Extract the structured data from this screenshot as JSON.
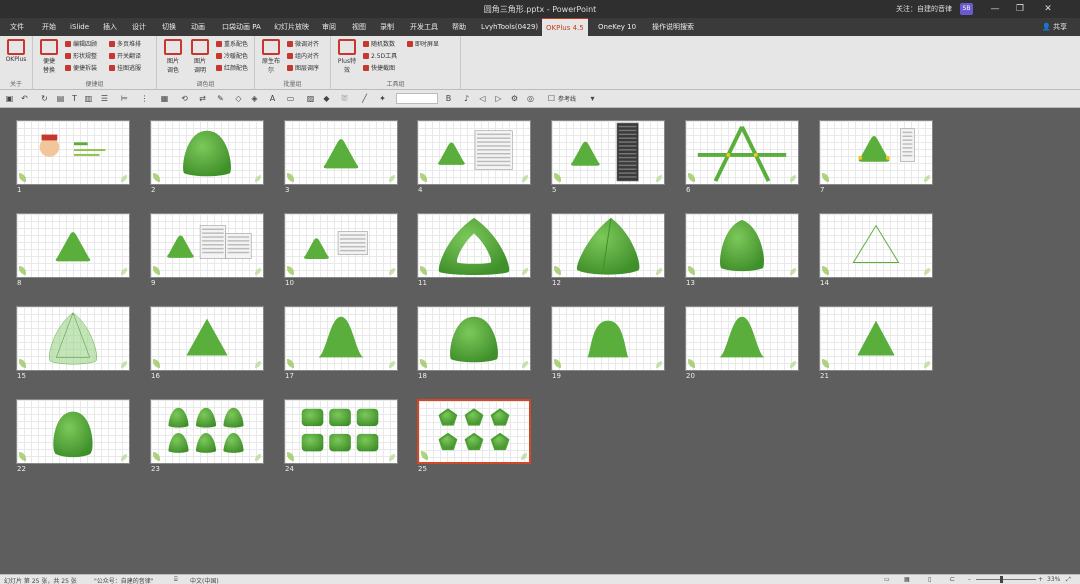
{
  "window": {
    "title": "圆角三角形.pptx - PowerPoint",
    "follow_text": "关注：自建的音律",
    "account_badge": "SB",
    "minimize": "—",
    "restore": "❐",
    "close": "✕"
  },
  "tabs": [
    {
      "label": "文件",
      "active": false
    },
    {
      "label": "开始",
      "active": false
    },
    {
      "label": "iSlide",
      "active": false
    },
    {
      "label": "插入",
      "active": false
    },
    {
      "label": "设计",
      "active": false
    },
    {
      "label": "切换",
      "active": false
    },
    {
      "label": "动画",
      "active": false
    },
    {
      "label": "口袋动画 PA",
      "active": false
    },
    {
      "label": "幻灯片放映",
      "active": false
    },
    {
      "label": "审阅",
      "active": false
    },
    {
      "label": "视图",
      "active": false
    },
    {
      "label": "录制",
      "active": false
    },
    {
      "label": "开发工具",
      "active": false
    },
    {
      "label": "帮助",
      "active": false
    },
    {
      "label": "LvyhTools(0429)",
      "active": false
    },
    {
      "label": "OKPlus 4.5",
      "active": true
    },
    {
      "label": "OneKey 10",
      "active": false
    },
    {
      "label": "操作说明搜索",
      "active": false
    }
  ],
  "share_label": "共享",
  "ribbon": {
    "groups": [
      {
        "label": "关于",
        "big": [
          {
            "label": "OKPlus",
            "icon": "okplus-logo-icon"
          }
        ],
        "small": []
      },
      {
        "label": "便捷组",
        "big": [
          {
            "label": "便捷\n替换",
            "icon": "replace-icon"
          }
        ],
        "small": [
          "编辑四顾",
          "形状规整",
          "便捷拆装",
          "多页堆排",
          "开关翻译",
          "挂图逃服"
        ]
      },
      {
        "label": "调色组",
        "big": [
          {
            "label": "图片\n调色",
            "icon": "img-icon"
          },
          {
            "label": "图片\n调明",
            "icon": "img-adjust-icon"
          }
        ],
        "small": [
          "重系配色",
          "冷暖配色",
          "红颜配色"
        ]
      },
      {
        "label": "批量组",
        "big": [
          {
            "label": "原生布\n尔",
            "icon": "boolean-icon"
          }
        ],
        "small": [
          "微调对齐",
          "组内对齐",
          "图层调序"
        ]
      },
      {
        "label": "工具组",
        "big": [
          {
            "label": "Plus特\n效",
            "icon": "plus-effect-icon"
          }
        ],
        "small": [
          "随机数数",
          "2.5D工具",
          "快捷截图",
          "即时屏显"
        ]
      }
    ]
  },
  "qat": {
    "zoom_box": "",
    "reference_label": "参考线"
  },
  "slides": [
    {
      "num": "1",
      "shape": "cover",
      "label": "演示"
    },
    {
      "num": "2",
      "shape": "blob"
    },
    {
      "num": "3",
      "shape": "rtri"
    },
    {
      "num": "4",
      "shape": "rtri-panel"
    },
    {
      "num": "5",
      "shape": "rtri-darkpanel"
    },
    {
      "num": "6",
      "shape": "a-lines"
    },
    {
      "num": "7",
      "shape": "rtri-dots"
    },
    {
      "num": "8",
      "shape": "rtri"
    },
    {
      "num": "9",
      "shape": "rtri-dialogs"
    },
    {
      "num": "10",
      "shape": "rtri-dialog"
    },
    {
      "num": "11",
      "shape": "ring"
    },
    {
      "num": "12",
      "shape": "rtri-3d"
    },
    {
      "num": "13",
      "shape": "blob-tall"
    },
    {
      "num": "14",
      "shape": "outline"
    },
    {
      "num": "15",
      "shape": "ghost"
    },
    {
      "num": "16",
      "shape": "tri-sharp"
    },
    {
      "num": "17",
      "shape": "bell"
    },
    {
      "num": "18",
      "shape": "blob"
    },
    {
      "num": "19",
      "shape": "dome"
    },
    {
      "num": "20",
      "shape": "bell"
    },
    {
      "num": "21",
      "shape": "tri-label"
    },
    {
      "num": "22",
      "shape": "blob-label"
    },
    {
      "num": "23",
      "shape": "grid-tri"
    },
    {
      "num": "24",
      "shape": "grid-square"
    },
    {
      "num": "25",
      "shape": "grid-pent",
      "selected": true
    }
  ],
  "status": {
    "slide_info": "幻灯片 第 25 张，共 25 张",
    "wechat": "\"公众号：自建的音律\"",
    "language": "中文(中国)",
    "zoom": "33%",
    "zoom_minus": "–",
    "zoom_plus": "+"
  },
  "colors": {
    "green": "#5aae3c",
    "green_dark": "#3f8f2a",
    "accent": "#c43e1c"
  }
}
